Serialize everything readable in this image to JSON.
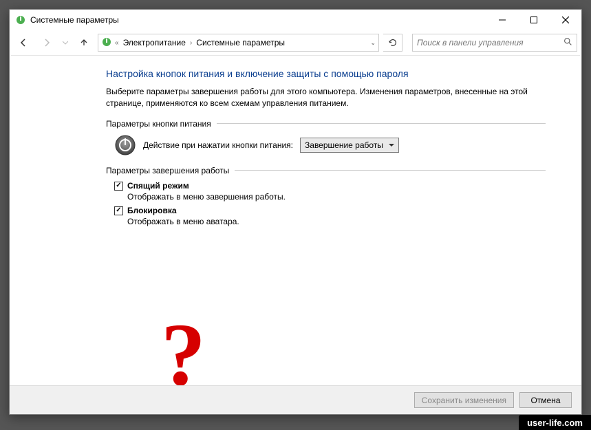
{
  "window": {
    "title": "Системные параметры"
  },
  "breadcrumb": {
    "item1": "Электропитание",
    "item2": "Системные параметры"
  },
  "search": {
    "placeholder": "Поиск в панели управления"
  },
  "page": {
    "title": "Настройка кнопок питания и включение защиты с помощью пароля",
    "description": "Выберите параметры завершения работы для этого компьютера. Изменения параметров, внесенные на этой странице, применяются ко всем схемам управления питанием."
  },
  "groups": {
    "power_button": "Параметры кнопки питания",
    "shutdown": "Параметры завершения работы"
  },
  "power_action": {
    "label": "Действие при нажатии кнопки питания:",
    "selected": "Завершение работы"
  },
  "options": {
    "sleep": {
      "label": "Спящий режим",
      "desc": "Отображать в меню завершения работы.",
      "checked": true
    },
    "lock": {
      "label": "Блокировка",
      "desc": "Отображать в меню аватара.",
      "checked": true
    }
  },
  "buttons": {
    "save": "Сохранить изменения",
    "cancel": "Отмена"
  },
  "overlay": {
    "qmark": "?"
  },
  "watermark": "user-life.com"
}
